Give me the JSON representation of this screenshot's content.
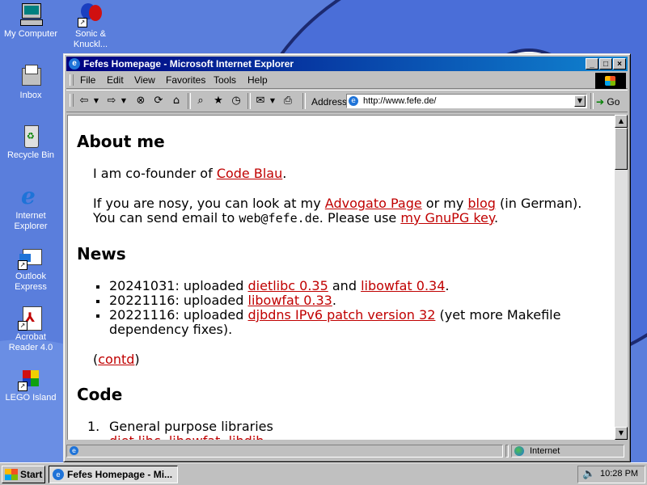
{
  "desktop": {
    "icons": [
      {
        "label": "My Computer"
      },
      {
        "label": "Sonic & Knuckl..."
      },
      {
        "label": "Inbox"
      },
      {
        "label": "Recycle Bin"
      },
      {
        "label": "Internet Explorer"
      },
      {
        "label": "Outlook Express"
      },
      {
        "label": "Acrobat Reader 4.0"
      },
      {
        "label": "LEGO Island"
      }
    ]
  },
  "window": {
    "title": "Fefes Homepage - Microsoft Internet Explorer",
    "controls": {
      "minimize": "_",
      "maximize": "□",
      "close": "×"
    }
  },
  "menu": [
    "File",
    "Edit",
    "View",
    "Favorites",
    "Tools",
    "Help"
  ],
  "toolbar": {
    "address_label": "Address",
    "address_value": "http://www.fefe.de/",
    "go_label": "Go",
    "buttons": [
      "back",
      "forward",
      "stop",
      "refresh",
      "home",
      "search",
      "favorites",
      "history",
      "mail",
      "print"
    ]
  },
  "page": {
    "about_heading": "About me",
    "about_p1_pre": "I am co-founder of ",
    "about_p1_link": "Code Blau",
    "about_p1_post": ".",
    "about_p2_a": "If you are nosy, you can look at my ",
    "about_p2_link1": "Advogato Page",
    "about_p2_b": " or my ",
    "about_p2_link2": "blog",
    "about_p2_c": " (in German).",
    "about_p3_a": "You can send email to ",
    "about_p3_email": "web@fefe.de",
    "about_p3_b": ". Please use ",
    "about_p3_link": "my GnuPG key",
    "about_p3_c": ".",
    "news_heading": "News",
    "news": [
      {
        "pre": "20241031: uploaded ",
        "link1": "dietlibc 0.35",
        "mid": " and ",
        "link2": "libowfat 0.34",
        "post": "."
      },
      {
        "pre": "20221116: uploaded ",
        "link1": "libowfat 0.33",
        "post": "."
      },
      {
        "pre": "20221116: uploaded ",
        "link1": "djbdns IPv6 patch version 32",
        "post": " (yet more Makefile",
        "line2": "dependency fixes)."
      }
    ],
    "contd_pre": "(",
    "contd_link": "contd",
    "contd_post": ")",
    "code_heading": "Code",
    "code_item1_num": "1.",
    "code_item1": "General purpose libraries",
    "code_item1_links": "diet libc, libowfat, libdjb"
  },
  "status": {
    "zone": "Internet"
  },
  "taskbar": {
    "start_label": "Start",
    "task_label": "Fefes Homepage - Mi...",
    "clock": "10:28 PM"
  },
  "colors": {
    "desktop": "#5a7edc",
    "link": "#c00000",
    "titlebar": "#000080"
  }
}
